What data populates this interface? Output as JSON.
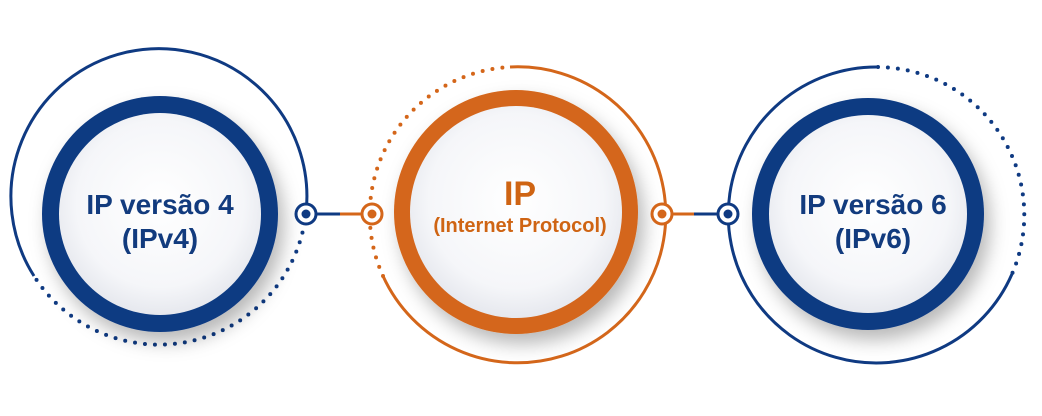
{
  "nodes": {
    "left": {
      "line1": "IP versão 4",
      "line2": "(IPv4)"
    },
    "center": {
      "line1": "IP",
      "line2": "(Internet Protocol)"
    },
    "right": {
      "line1": "IP versão 6",
      "line2": "(IPv6)"
    }
  },
  "colors": {
    "navy": "#0f3a82",
    "navy_text": "#123b7e",
    "orange": "#d4661a",
    "orange_text": "#cf6413",
    "inner_fill": "#f4f5f8"
  }
}
